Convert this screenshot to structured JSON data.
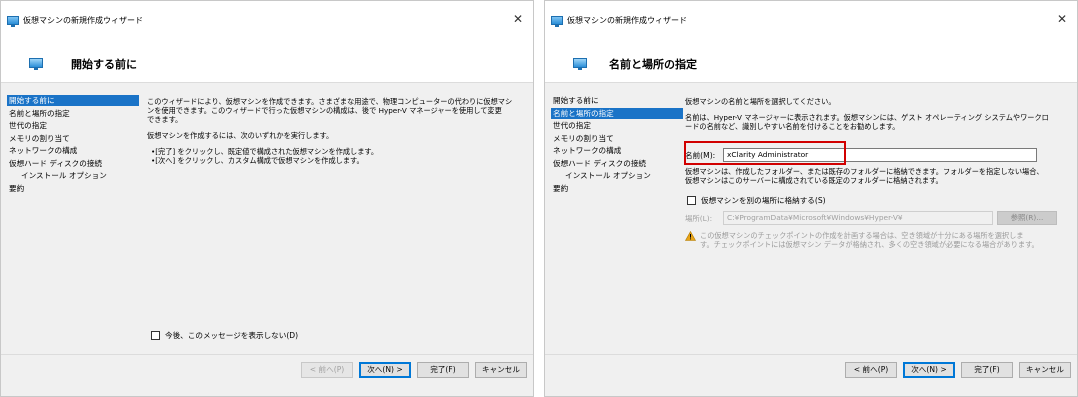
{
  "window_title": "仮想マシンの新規作成ウィザード",
  "close_glyph": "✕",
  "nav_items": [
    {
      "label": "開始する前に",
      "sub": false
    },
    {
      "label": "名前と場所の指定",
      "sub": false
    },
    {
      "label": "世代の指定",
      "sub": false
    },
    {
      "label": "メモリの割り当て",
      "sub": false
    },
    {
      "label": "ネットワークの構成",
      "sub": false
    },
    {
      "label": "仮想ハード ディスクの接続",
      "sub": false
    },
    {
      "label": "インストール オプション",
      "sub": true
    },
    {
      "label": "要約",
      "sub": false
    }
  ],
  "buttons": {
    "previous": "< 前へ(P)",
    "next": "次へ(N) >",
    "finish": "完了(F)",
    "cancel": "キャンセル"
  },
  "page1": {
    "header": "開始する前に",
    "active_index": 0,
    "para1": "このウィザードにより、仮想マシンを作成できます。さまざまな用途で、物理コンピューターの代わりに仮想マシ\nンを使用できます。このウィザードで行った仮想マシンの構成は、後で Hyper-V マネージャーを使用して変更\nできます。",
    "para2": "仮想マシンを作成するには、次のいずれかを実行します。",
    "bullet1": "•[完了] をクリックし、既定値で構成された仮想マシンを作成します。",
    "bullet2": "•[次へ] をクリックし、カスタム構成で仮想マシンを作成します。",
    "dont_show": "今後、このメッセージを表示しない(D)",
    "previous_disabled": true
  },
  "page2": {
    "header": "名前と場所の指定",
    "active_index": 1,
    "para1": "仮想マシンの名前と場所を選択してください。",
    "para2": "名前は、Hyper-V マネージャーに表示されます。仮想マシンには、ゲスト オペレーティング システムやワークロ\nードの名前など、識別しやすい名前を付けることをお勧めします。",
    "name_label": "名前(M):",
    "name_value": "xClarity Administrator",
    "para3": "仮想マシンは、作成したフォルダー、または既存のフォルダーに格納できます。フォルダーを指定しない場合、\n仮想マシンはこのサーバーに構成されている既定のフォルダーに格納されます。",
    "store_elsewhere": "仮想マシンを別の場所に格納する(S)",
    "location_label": "場所(L):",
    "location_value": "C:¥ProgramData¥Microsoft¥Windows¥Hyper-V¥",
    "browse": "参照(R)...",
    "warning": "この仮想マシンのチェックポイントの作成を計画する場合は、空き領域が十分にある場所を選択しま\nす。チェックポイントには仮想マシン データが格納され、多くの空き領域が必要になる場合があります。"
  }
}
